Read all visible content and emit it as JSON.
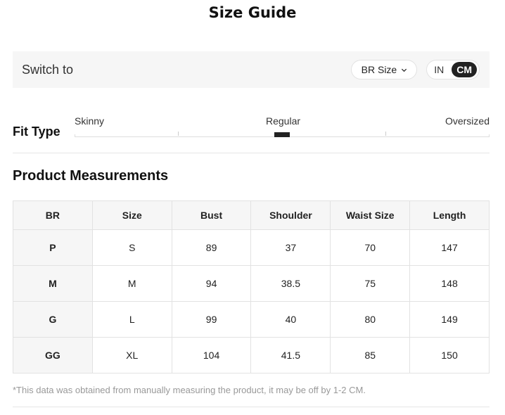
{
  "title": "Size Guide",
  "switch_bar": {
    "label": "Switch to",
    "size_select": "BR Size",
    "units": [
      "IN",
      "CM"
    ],
    "active_unit": "CM"
  },
  "fit": {
    "label": "Fit Type",
    "scale": [
      "Skinny",
      "Regular",
      "Oversized"
    ],
    "selected": "Regular"
  },
  "measurements": {
    "title": "Product Measurements",
    "headers": [
      "BR",
      "Size",
      "Bust",
      "Shoulder",
      "Waist Size",
      "Length"
    ],
    "rows": [
      [
        "P",
        "S",
        "89",
        "37",
        "70",
        "147"
      ],
      [
        "M",
        "M",
        "94",
        "38.5",
        "75",
        "148"
      ],
      [
        "G",
        "L",
        "99",
        "40",
        "80",
        "149"
      ],
      [
        "GG",
        "XL",
        "104",
        "41.5",
        "85",
        "150"
      ]
    ]
  },
  "note": "*This data was obtained from manually measuring the product, it may be off by 1-2 CM.",
  "colors": {
    "panel_bg": "#f6f6f6",
    "active_unit_bg": "#222222",
    "border": "#e2e2e2",
    "note_text": "#999999"
  },
  "icons": {
    "size_select": "chevron-down-icon"
  }
}
